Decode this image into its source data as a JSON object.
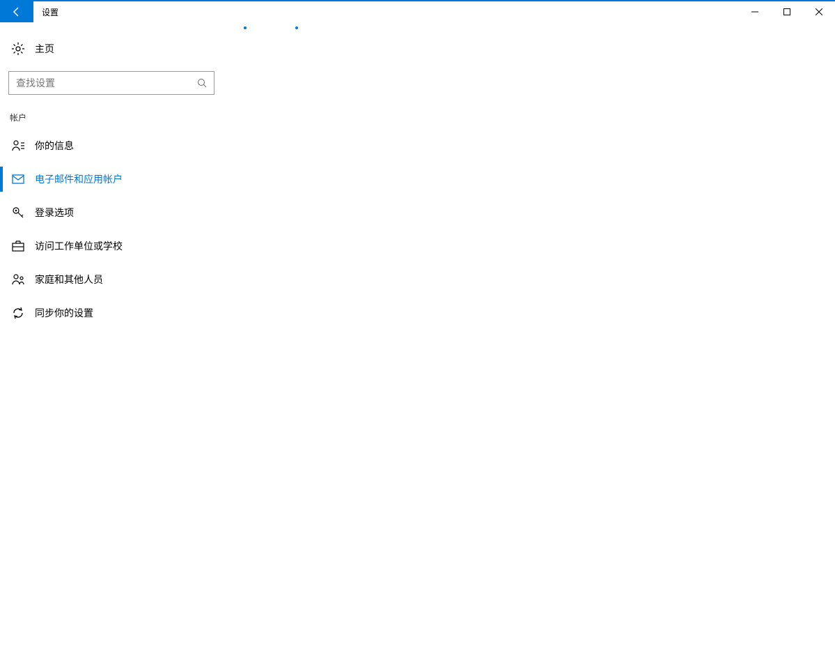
{
  "window": {
    "title": "设置"
  },
  "home": {
    "label": "主页"
  },
  "search": {
    "placeholder": "查找设置"
  },
  "section": {
    "title": "帐户"
  },
  "nav": {
    "items": [
      {
        "label": "你的信息",
        "icon": "user-icon",
        "active": false
      },
      {
        "label": "电子邮件和应用帐户",
        "icon": "mail-icon",
        "active": true
      },
      {
        "label": "登录选项",
        "icon": "key-icon",
        "active": false
      },
      {
        "label": "访问工作单位或学校",
        "icon": "briefcase-icon",
        "active": false
      },
      {
        "label": "家庭和其他人员",
        "icon": "people-icon",
        "active": false
      },
      {
        "label": "同步你的设置",
        "icon": "sync-icon",
        "active": false
      }
    ]
  },
  "colors": {
    "accent": "#0078d7"
  }
}
